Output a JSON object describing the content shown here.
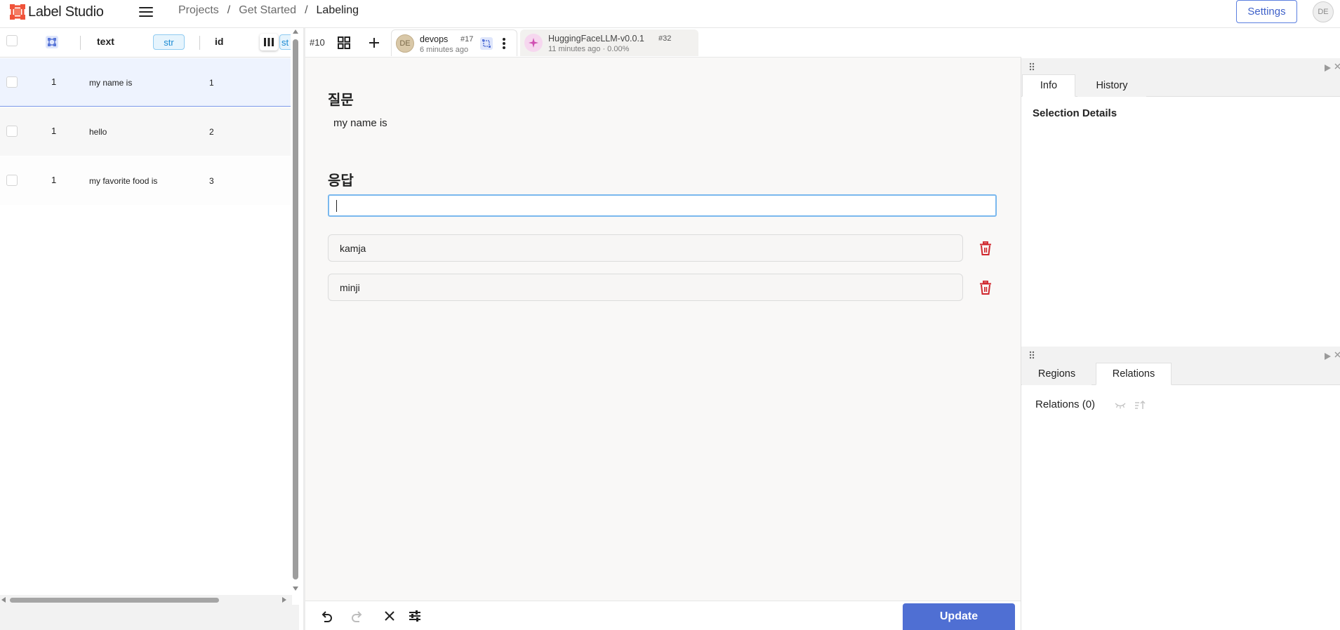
{
  "app": {
    "name": "Label Studio",
    "user_initials": "DE"
  },
  "breadcrumb": {
    "items": [
      "Projects",
      "Get Started",
      "Labeling"
    ],
    "separator": "/"
  },
  "header": {
    "settings_label": "Settings"
  },
  "table": {
    "columns": {
      "text": "text",
      "text_type": "str",
      "id": "id",
      "extra_type": "st"
    },
    "rows": [
      {
        "count": "1",
        "text": "my name is",
        "id": "1"
      },
      {
        "count": "1",
        "text": "hello",
        "id": "2"
      },
      {
        "count": "1",
        "text": "my favorite food is",
        "id": "3"
      }
    ]
  },
  "annotation_tabs": {
    "task_id": "#10",
    "active": {
      "avatar": "DE",
      "user": "devops",
      "id": "#17",
      "time": "6 minutes ago"
    },
    "prediction": {
      "model": "HuggingFaceLLM-v0.0.1",
      "id": "#32",
      "time": "11 minutes ago · 0.00%"
    }
  },
  "labeling": {
    "question_title": "질문",
    "question_text": "my name is",
    "answer_title": "응답",
    "answer_value": "",
    "responses": [
      "kamja",
      "minji"
    ]
  },
  "toolbar": {
    "update_label": "Update"
  },
  "right_panel": {
    "top_tabs": [
      "Info",
      "History"
    ],
    "selection_details": "Selection Details",
    "bottom_tabs": [
      "Regions",
      "Relations"
    ],
    "relations_label": "Relations (0)"
  },
  "colors": {
    "accent": "#4f6fd3",
    "delete": "#d0262d",
    "selected_row": "#eef3fe",
    "input_focus": "#7ab8ee"
  },
  "icons": [
    "hamburger-icon",
    "grid-icon",
    "plus-icon",
    "kebab-icon",
    "sparkle-icon",
    "undo-icon",
    "redo-icon",
    "close-icon",
    "settings-sliders-icon",
    "trash-icon",
    "columns-icon",
    "eye-icon",
    "sort-icon",
    "drag-handle-icon",
    "expand-icon"
  ]
}
